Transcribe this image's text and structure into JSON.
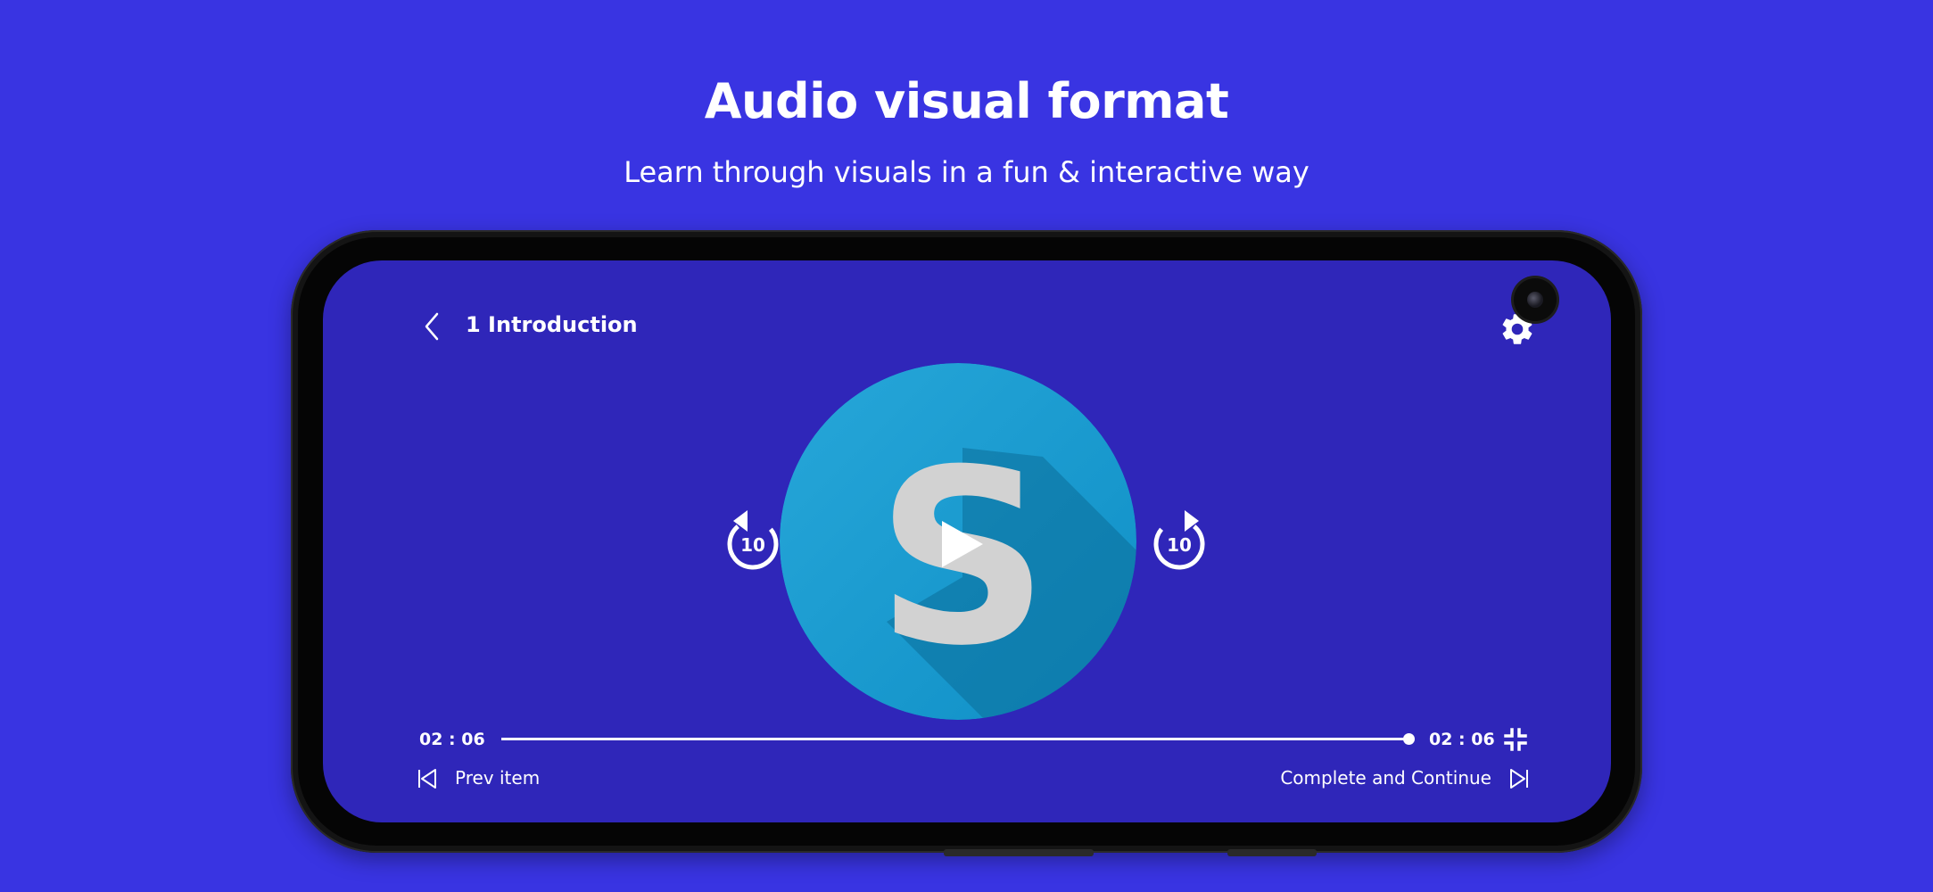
{
  "hero": {
    "title": "Audio visual format",
    "subtitle": "Learn through visuals in a fun & interactive way"
  },
  "player": {
    "lesson_title": "1 Introduction",
    "current_time": "02 : 06",
    "total_time": "02 : 06",
    "progress": 1.0,
    "rewind_seconds": "10",
    "forward_seconds": "10",
    "prev_label": "Prev item",
    "next_label": "Complete and Continue",
    "logo_letter": "S"
  },
  "icons": {
    "back": "chevron-left-icon",
    "settings": "gear-icon",
    "rewind": "replay-10-icon",
    "forward": "forward-10-icon",
    "play": "play-icon",
    "exit_fullscreen": "exit-fullscreen-icon",
    "prev": "skip-previous-icon",
    "next": "skip-next-icon"
  },
  "colors": {
    "background": "#3934e2",
    "screen": "#2f26b9",
    "logo_circle": "#1f9fd6",
    "logo_letter": "#d2d2d2"
  }
}
